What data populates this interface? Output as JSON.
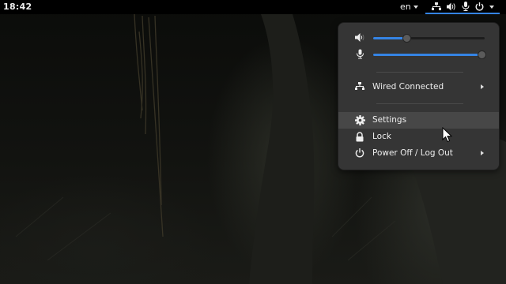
{
  "topbar": {
    "time": "18:42",
    "language": "en",
    "status_icons": [
      "network-wired-icon",
      "volume-icon",
      "microphone-icon",
      "power-icon"
    ],
    "accent_color": "#3584e4"
  },
  "menu": {
    "volume": {
      "icon": "speaker-icon",
      "level": 0.3
    },
    "microphone": {
      "icon": "microphone-icon",
      "level": 0.97
    },
    "network": {
      "label": "Wired Connected",
      "icon": "network-wired-icon",
      "has_submenu": true
    },
    "settings": {
      "label": "Settings",
      "icon": "gear-icon",
      "hovered": true
    },
    "lock": {
      "label": "Lock",
      "icon": "lock-icon"
    },
    "power": {
      "label": "Power Off / Log Out",
      "icon": "power-icon",
      "has_submenu": true
    }
  }
}
